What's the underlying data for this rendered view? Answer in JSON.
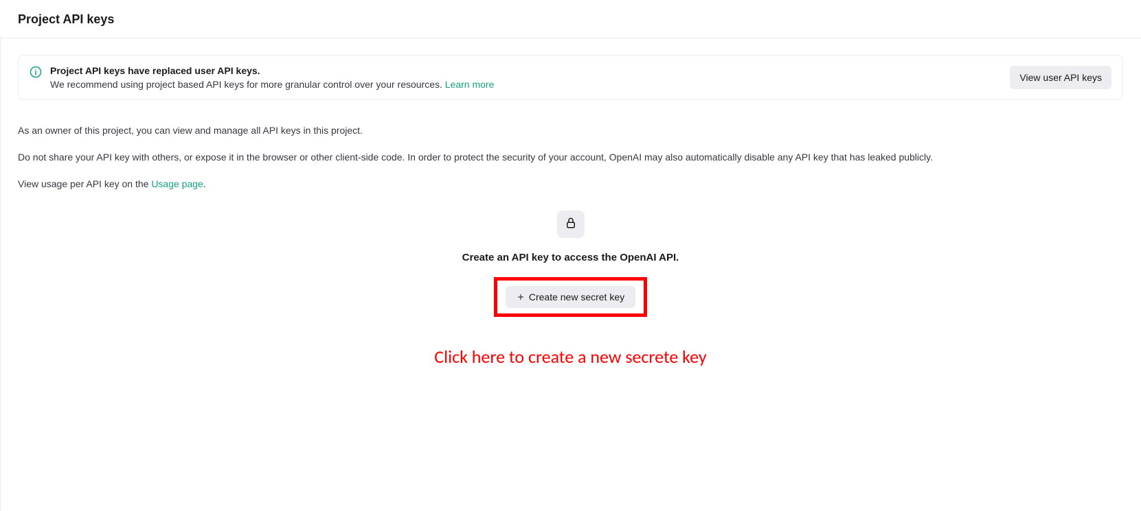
{
  "header": {
    "title": "Project API keys"
  },
  "banner": {
    "title": "Project API keys have replaced user API keys.",
    "desc_prefix": "We recommend using project based API keys for more granular control over your resources. ",
    "learn_more": "Learn more",
    "view_user_button": "View user API keys"
  },
  "body": {
    "line1": "As an owner of this project, you can view and manage all API keys in this project.",
    "line2": "Do not share your API key with others, or expose it in the browser or other client-side code. In order to protect the security of your account, OpenAI may also automatically disable any API key that has leaked publicly.",
    "line3_prefix": "View usage per API key on the ",
    "usage_link": "Usage page",
    "line3_suffix": "."
  },
  "empty": {
    "headline": "Create an API key to access the OpenAI API.",
    "create_button": "Create new secret key"
  },
  "annotation": {
    "text": "Click here to create a new secrete key"
  }
}
